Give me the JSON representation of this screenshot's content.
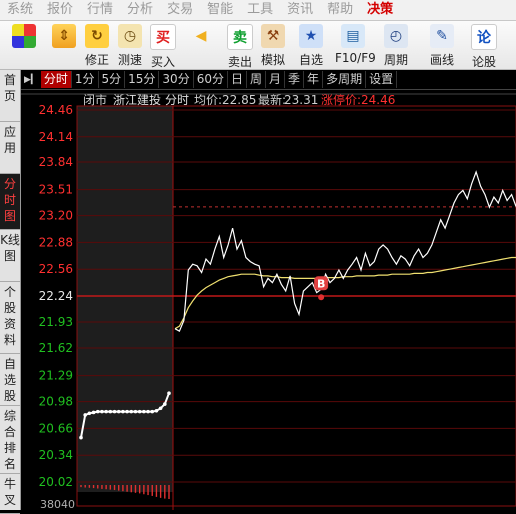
{
  "menu": [
    "系统",
    "报价",
    "行情",
    "分析",
    "交易",
    "智能",
    "工具",
    "资讯",
    "帮助",
    "决策"
  ],
  "menu_active": "决策",
  "toolbar": [
    {
      "name": "color-block",
      "label": ""
    },
    {
      "name": "up-down",
      "label": ""
    },
    {
      "name": "xiuzheng",
      "label": "修正"
    },
    {
      "name": "cesu",
      "label": "测速"
    },
    {
      "name": "mairu",
      "label": "买入"
    },
    {
      "name": "back",
      "label": ""
    },
    {
      "name": "maichu",
      "label": "卖出"
    },
    {
      "name": "moni",
      "label": "模拟"
    },
    {
      "name": "zixuan",
      "label": "自选"
    },
    {
      "name": "f10",
      "label": "F10/F9"
    },
    {
      "name": "zhouqi",
      "label": "周期"
    },
    {
      "name": "huaxian",
      "label": "画线"
    },
    {
      "name": "lungu",
      "label": "论股"
    }
  ],
  "toolbar_icon_text": {
    "mairu": "买",
    "maichu": "卖",
    "lungu": "论"
  },
  "sidenav": [
    "首页",
    "应用",
    "分时图",
    "K线图",
    "个股资料",
    "自选股",
    "综合排名",
    "牛叉"
  ],
  "sidenav_active": "分时图",
  "periods": [
    "分时",
    "1分",
    "5分",
    "15分",
    "30分",
    "60分",
    "日",
    "周",
    "月",
    "季",
    "年",
    "多周期",
    "设置"
  ],
  "period_active": "分时",
  "chart": {
    "status": "闭市",
    "stock_name": "浙江建投",
    "view": "分时",
    "avg_label": "均价:",
    "avg_price": "22.85",
    "last_label": "最新:",
    "last_price": "23.31",
    "limit_label": "涨停价:",
    "limit_price": "24.46",
    "marker": "B",
    "volume_axis_label": "38040"
  },
  "chart_data": {
    "type": "line",
    "y_ticks": [
      24.46,
      24.14,
      23.84,
      23.51,
      23.2,
      22.88,
      22.56,
      22.24,
      21.93,
      21.62,
      21.29,
      20.98,
      20.66,
      20.34,
      20.02
    ],
    "prev_close": 22.24,
    "limit_up": 24.46,
    "preopen_price": [
      20.55,
      20.82,
      20.84,
      20.85,
      20.86,
      20.86,
      20.86,
      20.86,
      20.86,
      20.86,
      20.86,
      20.86,
      20.86,
      20.86,
      20.86,
      20.86,
      20.86,
      20.86,
      20.87,
      20.9,
      20.95,
      21.08
    ],
    "price": [
      21.85,
      21.82,
      21.95,
      22.55,
      22.62,
      22.6,
      22.52,
      22.68,
      22.62,
      22.8,
      22.95,
      22.7,
      22.85,
      23.05,
      22.8,
      22.9,
      22.7,
      22.65,
      22.62,
      22.6,
      22.35,
      22.45,
      22.4,
      22.5,
      22.38,
      22.3,
      22.48,
      22.15,
      22.02,
      22.3,
      22.35,
      22.4,
      22.28,
      22.32,
      22.5,
      22.4,
      22.45,
      22.55,
      22.45,
      22.55,
      22.62,
      22.7,
      22.55,
      22.75,
      22.6,
      22.65,
      22.8,
      22.85,
      22.8,
      22.7,
      22.62,
      22.72,
      22.68,
      22.6,
      22.72,
      22.8,
      22.7,
      22.75,
      22.85,
      23.0,
      23.15,
      23.05,
      23.2,
      23.35,
      23.45,
      23.5,
      23.4,
      23.58,
      23.72,
      23.55,
      23.45,
      23.3,
      23.42,
      23.35,
      23.5,
      23.38,
      23.45,
      23.31
    ],
    "avg_price": [
      21.85,
      21.88,
      21.98,
      22.1,
      22.18,
      22.25,
      22.3,
      22.34,
      22.37,
      22.4,
      22.43,
      22.45,
      22.47,
      22.48,
      22.49,
      22.5,
      22.5,
      22.5,
      22.5,
      22.49,
      22.48,
      22.48,
      22.47,
      22.47,
      22.46,
      22.46,
      22.46,
      22.45,
      22.45,
      22.45,
      22.45,
      22.45,
      22.45,
      22.45,
      22.46,
      22.46,
      22.46,
      22.46,
      22.47,
      22.47,
      22.47,
      22.48,
      22.48,
      22.48,
      22.48,
      22.48,
      22.49,
      22.49,
      22.49,
      22.5,
      22.5,
      22.5,
      22.5,
      22.5,
      22.51,
      22.51,
      22.51,
      22.52,
      22.52,
      22.53,
      22.54,
      22.55,
      22.56,
      22.57,
      22.58,
      22.59,
      22.6,
      22.61,
      22.62,
      22.63,
      22.64,
      22.65,
      22.66,
      22.67,
      22.68,
      22.69,
      22.7,
      22.7
    ],
    "marker_index": 33,
    "preopen_volume": [
      0.15,
      0.18,
      0.2,
      0.22,
      0.25,
      0.28,
      0.3,
      0.33,
      0.36,
      0.4,
      0.44,
      0.48,
      0.52,
      0.56,
      0.6,
      0.66,
      0.72,
      0.78,
      0.85,
      0.92,
      0.97,
      1.0
    ]
  }
}
